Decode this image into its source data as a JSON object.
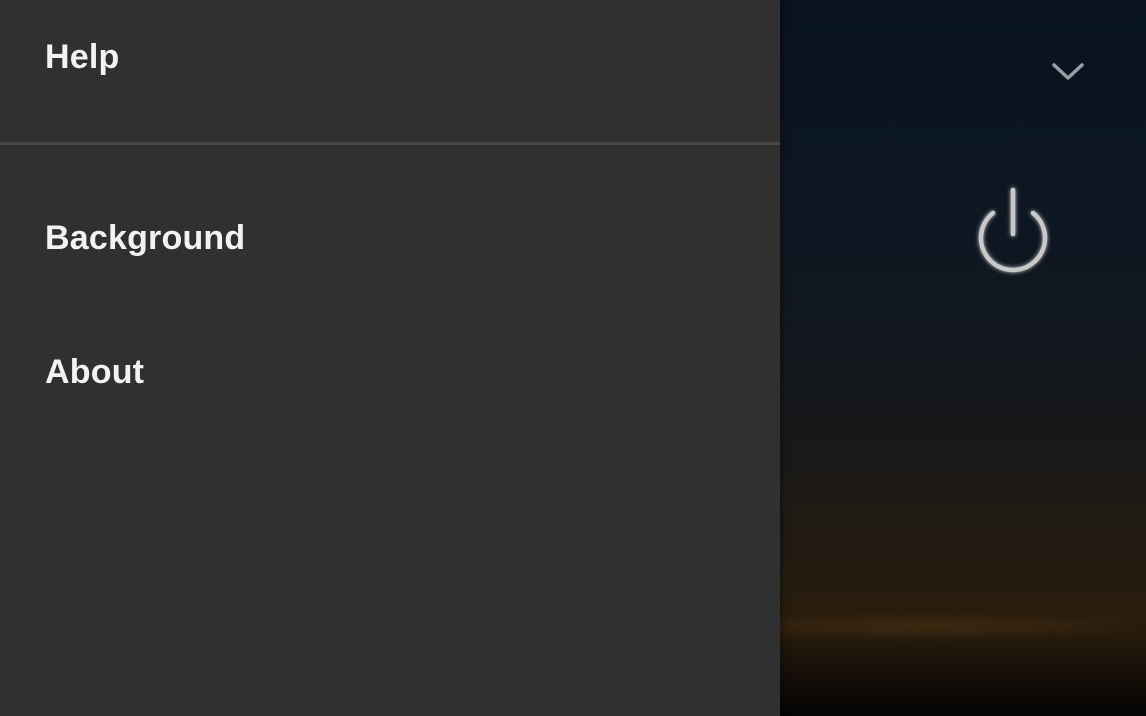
{
  "drawer": {
    "items": [
      {
        "label": "Help"
      },
      {
        "label": "Background"
      },
      {
        "label": "About"
      }
    ]
  },
  "background_screen": {
    "icons": [
      "chevron-down-icon",
      "power-icon"
    ]
  },
  "colors": {
    "drawer_bg": "#303030",
    "divider": "#474747",
    "text": "#f2f2f2"
  }
}
